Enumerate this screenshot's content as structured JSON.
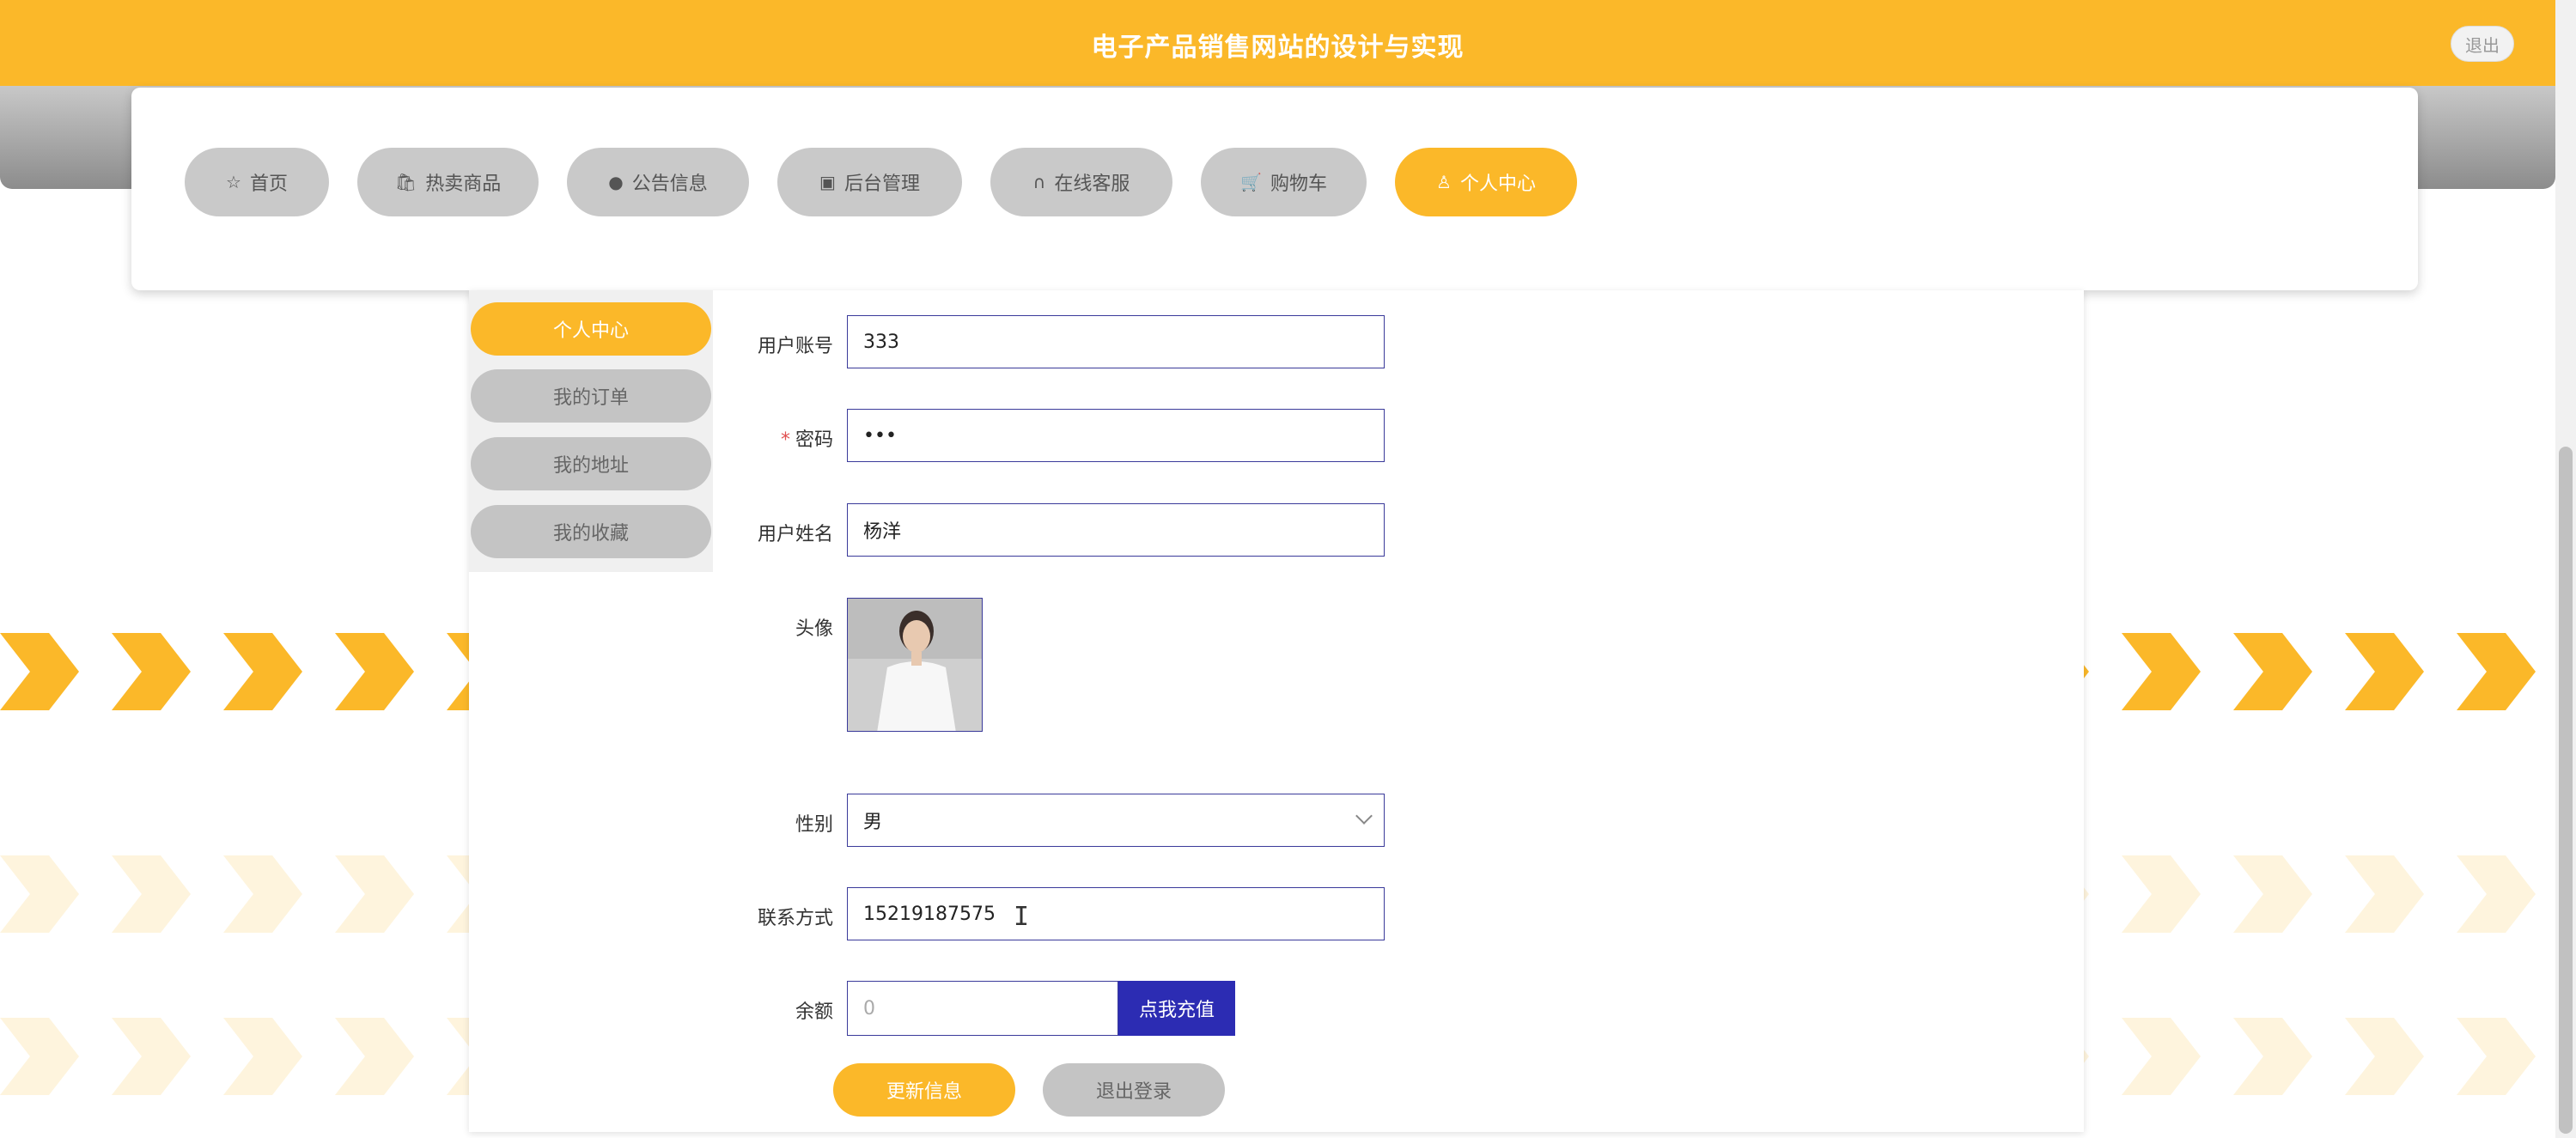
{
  "header": {
    "site_title": "电子产品销售网站的设计与实现",
    "logout_label": "退出"
  },
  "nav": {
    "items": [
      {
        "label": "首页",
        "icon": "star-icon"
      },
      {
        "label": "热卖商品",
        "icon": "bag-icon"
      },
      {
        "label": "公告信息",
        "icon": "alert-icon"
      },
      {
        "label": "后台管理",
        "icon": "briefcase-icon"
      },
      {
        "label": "在线客服",
        "icon": "headset-icon"
      },
      {
        "label": "购物车",
        "icon": "cart-icon"
      },
      {
        "label": "个人中心",
        "icon": "user-icon"
      }
    ],
    "active_index": 6
  },
  "side_menu": {
    "items": [
      "个人中心",
      "我的订单",
      "我的地址",
      "我的收藏"
    ],
    "active_index": 0
  },
  "form": {
    "account_label": "用户账号",
    "account_value": "333",
    "password_label": "密码",
    "password_required_mark": "*",
    "password_value": "•••",
    "name_label": "用户姓名",
    "name_value": "杨洋",
    "avatar_label": "头像",
    "gender_label": "性别",
    "gender_value": "男",
    "phone_label": "联系方式",
    "phone_value": "15219187575",
    "balance_label": "余额",
    "balance_value": "0",
    "recharge_label": "点我充值",
    "update_label": "更新信息",
    "logout_label": "退出登录"
  },
  "colors": {
    "accent": "#fbb829",
    "primary_button": "#2c2cb3",
    "inactive": "#c9c9c9"
  }
}
